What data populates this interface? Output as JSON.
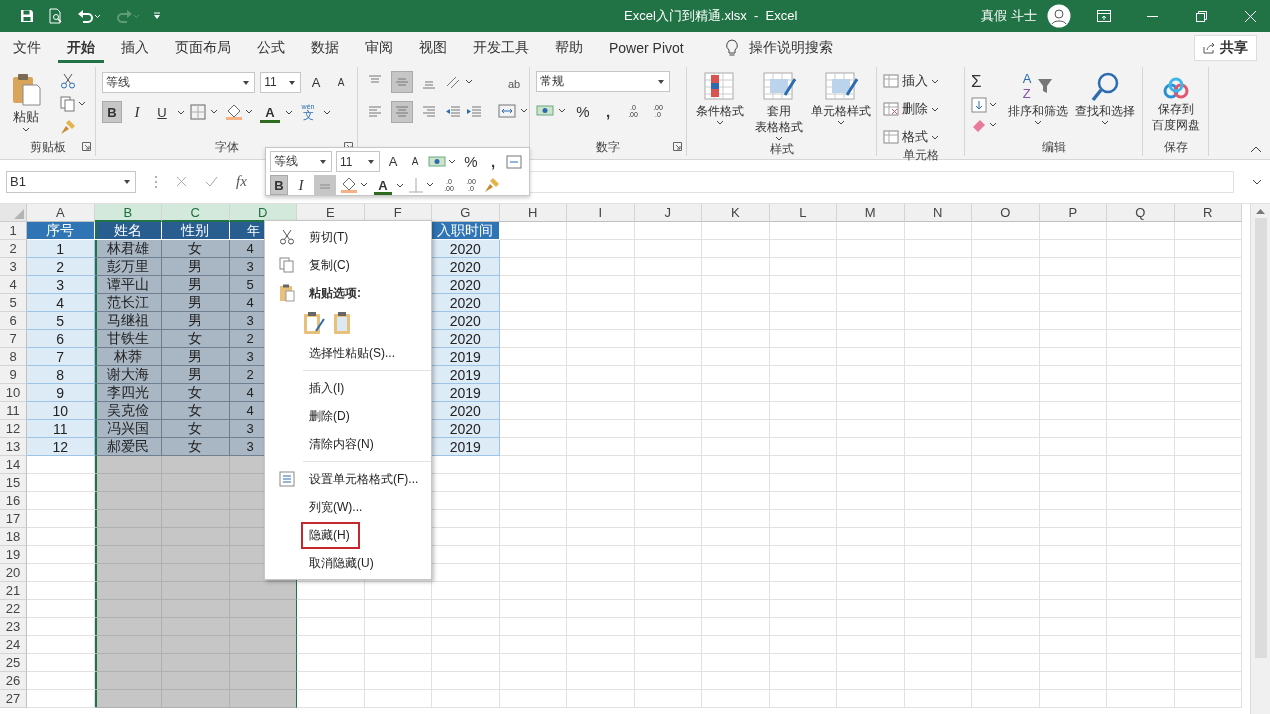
{
  "title_bar": {
    "title": "Excel入门到精通.xlsx  -  Excel",
    "user": "真假 斗士"
  },
  "tabs": [
    {
      "label": "文件",
      "selected": false
    },
    {
      "label": "开始",
      "selected": true
    },
    {
      "label": "插入",
      "selected": false
    },
    {
      "label": "页面布局",
      "selected": false
    },
    {
      "label": "公式",
      "selected": false
    },
    {
      "label": "数据",
      "selected": false
    },
    {
      "label": "审阅",
      "selected": false
    },
    {
      "label": "视图",
      "selected": false
    },
    {
      "label": "开发工具",
      "selected": false
    },
    {
      "label": "帮助",
      "selected": false
    },
    {
      "label": "Power Pivot",
      "selected": false
    }
  ],
  "tell_me": "操作说明搜索",
  "share": "共享",
  "ribbon": {
    "clipboard": {
      "paste": "粘贴",
      "label": "剪贴板"
    },
    "font": {
      "family": "等线",
      "size": "11",
      "grow": "A",
      "shrink": "A",
      "styles": [
        {
          "label": "B",
          "on": true
        },
        {
          "label": "I",
          "on": false
        },
        {
          "label": "U",
          "on": false
        }
      ],
      "font_color": "A",
      "phonetic": {
        "top": "wén",
        "main": "文"
      },
      "label": "字体"
    },
    "alignment": {
      "vertical": [
        {
          "on": false
        },
        {
          "on": true
        },
        {
          "on": false
        }
      ],
      "horizontal": [
        {
          "on": false
        },
        {
          "on": true
        },
        {
          "on": false
        }
      ],
      "wrap": "ab"
    },
    "number": {
      "format": "常规",
      "percent": "%",
      "comma": ",",
      "decimals": [
        {
          "top": ".0",
          "bottom": ".00"
        },
        {
          "top": ".00",
          "bottom": ".0"
        }
      ],
      "label": "数字"
    },
    "styles": {
      "buttons": [
        {
          "lines": [
            "条件格式"
          ]
        },
        {
          "lines": [
            "套用",
            "表格格式"
          ]
        },
        {
          "lines": [
            "单元格样式"
          ]
        }
      ],
      "label": "样式"
    },
    "cells": {
      "buttons": [
        "插入",
        "删除",
        "格式"
      ],
      "label": "单元格"
    },
    "editing": {
      "sum": "Σ",
      "sort_letters": [
        "A",
        "Z"
      ],
      "sort": "排序和筛选",
      "find": "查找和选择",
      "label": "编辑"
    },
    "save": {
      "lines": [
        "保存到",
        "百度网盘"
      ],
      "label": "保存"
    }
  },
  "name_box": "B1",
  "formula_label": "fx",
  "mini_toolbar": {
    "family": "等线",
    "size": "11",
    "grow": "A",
    "shrink": "A",
    "percent": "%",
    "comma": ",",
    "styles": [
      {
        "label": "B",
        "on": true
      },
      {
        "label": "I",
        "on": false
      }
    ],
    "font_color": "A",
    "decimals": [
      {
        "top": ".0",
        "bottom": ".00"
      },
      {
        "top": ".00",
        "bottom": ".0"
      }
    ]
  },
  "sheet": {
    "columns": [
      {
        "label": "A",
        "selected": false
      },
      {
        "label": "B",
        "selected": true
      },
      {
        "label": "C",
        "selected": true
      },
      {
        "label": "D",
        "selected": true
      },
      {
        "label": "E",
        "selected": false
      },
      {
        "label": "F",
        "selected": false
      },
      {
        "label": "G",
        "selected": false
      },
      {
        "label": "H",
        "selected": false
      },
      {
        "label": "I",
        "selected": false
      },
      {
        "label": "J",
        "selected": false
      },
      {
        "label": "K",
        "selected": false
      },
      {
        "label": "L",
        "selected": false
      },
      {
        "label": "M",
        "selected": false
      },
      {
        "label": "N",
        "selected": false
      },
      {
        "label": "O",
        "selected": false
      },
      {
        "label": "P",
        "selected": false
      },
      {
        "label": "Q",
        "selected": false
      },
      {
        "label": "R",
        "selected": false
      }
    ],
    "rows": [
      {
        "number": "1",
        "kind": "header",
        "cells": [
          {
            "text": "序号"
          },
          {
            "text": "姓名"
          },
          {
            "text": "性别"
          },
          {
            "text": "年"
          },
          {},
          {},
          {
            "text": "入职时间"
          }
        ]
      },
      {
        "number": "2",
        "kind": "data",
        "cells": [
          {
            "text": "1"
          },
          {
            "text": "林君雄"
          },
          {
            "text": "女"
          },
          {
            "text": "4"
          },
          {},
          {},
          {
            "text": "2020"
          }
        ]
      },
      {
        "number": "3",
        "kind": "data",
        "cells": [
          {
            "text": "2"
          },
          {
            "text": "彭万里"
          },
          {
            "text": "男"
          },
          {
            "text": "3"
          },
          {},
          {},
          {
            "text": "2020"
          }
        ]
      },
      {
        "number": "4",
        "kind": "data",
        "cells": [
          {
            "text": "3"
          },
          {
            "text": "谭平山"
          },
          {
            "text": "男"
          },
          {
            "text": "5"
          },
          {},
          {},
          {
            "text": "2020"
          }
        ]
      },
      {
        "number": "5",
        "kind": "data",
        "cells": [
          {
            "text": "4"
          },
          {
            "text": "范长江"
          },
          {
            "text": "男"
          },
          {
            "text": "4"
          },
          {},
          {},
          {
            "text": "2020"
          }
        ]
      },
      {
        "number": "6",
        "kind": "data",
        "cells": [
          {
            "text": "5"
          },
          {
            "text": "马继祖"
          },
          {
            "text": "男"
          },
          {
            "text": "3"
          },
          {},
          {},
          {
            "text": "2020"
          }
        ]
      },
      {
        "number": "7",
        "kind": "data",
        "cells": [
          {
            "text": "6"
          },
          {
            "text": "甘铁生"
          },
          {
            "text": "女"
          },
          {
            "text": "2"
          },
          {},
          {},
          {
            "text": "2020"
          }
        ]
      },
      {
        "number": "8",
        "kind": "data",
        "cells": [
          {
            "text": "7"
          },
          {
            "text": "林莽"
          },
          {
            "text": "男"
          },
          {
            "text": "3"
          },
          {},
          {},
          {
            "text": "2019"
          }
        ]
      },
      {
        "number": "9",
        "kind": "data",
        "cells": [
          {
            "text": "8"
          },
          {
            "text": "谢大海"
          },
          {
            "text": "男"
          },
          {
            "text": "2"
          },
          {},
          {},
          {
            "text": "2019"
          }
        ]
      },
      {
        "number": "10",
        "kind": "data",
        "cells": [
          {
            "text": "9"
          },
          {
            "text": "李四光"
          },
          {
            "text": "女"
          },
          {
            "text": "4"
          },
          {},
          {},
          {
            "text": "2019"
          }
        ]
      },
      {
        "number": "11",
        "kind": "data",
        "cells": [
          {
            "text": "10"
          },
          {
            "text": "吴克俭"
          },
          {
            "text": "女"
          },
          {
            "text": "4"
          },
          {},
          {},
          {
            "text": "2020"
          }
        ]
      },
      {
        "number": "12",
        "kind": "data",
        "cells": [
          {
            "text": "11"
          },
          {
            "text": "冯兴国"
          },
          {
            "text": "女"
          },
          {
            "text": "3"
          },
          {},
          {},
          {
            "text": "2020"
          }
        ]
      },
      {
        "number": "13",
        "kind": "data",
        "cells": [
          {
            "text": "12"
          },
          {
            "text": "郝爱民"
          },
          {
            "text": "女"
          },
          {
            "text": "3"
          },
          {},
          {},
          {
            "text": "2019"
          }
        ]
      },
      {
        "number": "14",
        "kind": "empty"
      },
      {
        "number": "15",
        "kind": "empty"
      },
      {
        "number": "16",
        "kind": "empty"
      },
      {
        "number": "17",
        "kind": "empty"
      },
      {
        "number": "18",
        "kind": "empty"
      },
      {
        "number": "19",
        "kind": "empty"
      },
      {
        "number": "20",
        "kind": "empty"
      },
      {
        "number": "21",
        "kind": "empty"
      },
      {
        "number": "22",
        "kind": "empty"
      },
      {
        "number": "23",
        "kind": "empty"
      },
      {
        "number": "24",
        "kind": "empty"
      },
      {
        "number": "25",
        "kind": "empty"
      },
      {
        "number": "26",
        "kind": "empty"
      },
      {
        "number": "27",
        "kind": "empty"
      }
    ]
  },
  "context_menu": [
    {
      "kind": "command",
      "label": "剪切(T)",
      "highlighted": false
    },
    {
      "kind": "command",
      "label": "复制(C)",
      "highlighted": false
    },
    {
      "kind": "heading",
      "label": "粘贴选项:"
    },
    {
      "kind": "paste_icons"
    },
    {
      "kind": "command",
      "label": "选择性粘贴(S)...",
      "highlighted": false
    },
    {
      "kind": "separator"
    },
    {
      "kind": "command",
      "label": "插入(I)",
      "highlighted": false
    },
    {
      "kind": "command",
      "label": "删除(D)",
      "highlighted": false
    },
    {
      "kind": "command",
      "label": "清除内容(N)",
      "highlighted": false
    },
    {
      "kind": "separator"
    },
    {
      "kind": "command",
      "label": "设置单元格格式(F)...",
      "highlighted": false
    },
    {
      "kind": "command",
      "label": "列宽(W)...",
      "highlighted": false
    },
    {
      "kind": "command",
      "label": "隐藏(H)",
      "highlighted": true
    },
    {
      "kind": "command",
      "label": "取消隐藏(U)",
      "highlighted": false
    }
  ]
}
